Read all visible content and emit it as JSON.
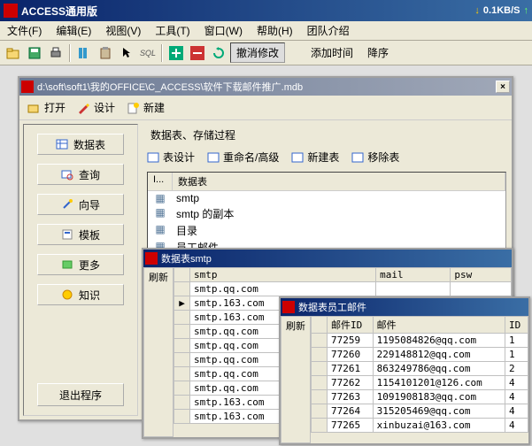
{
  "app": {
    "title": "ACCESS通用版",
    "net_speed": "0.1KB/S"
  },
  "menu": {
    "file": "文件(F)",
    "edit": "编辑(E)",
    "view": "视图(V)",
    "tools": "工具(T)",
    "window": "窗口(W)",
    "help": "帮助(H)",
    "team": "团队介绍"
  },
  "toolbar": {
    "sql": "SQL",
    "undo": "撤消修改",
    "add_time": "添加时间",
    "sort": "降序"
  },
  "dbwin": {
    "title": "d:\\soft\\soft1\\我的OFFICE\\C_ACCESS\\软件下载邮件推广.mdb",
    "open": "打开",
    "design": "设计",
    "new": "新建",
    "section_label": "数据表、存储过程",
    "sub": {
      "design_tbl": "表设计",
      "rename": "重命名/高级",
      "new_tbl": "新建表",
      "del_tbl": "移除表"
    },
    "sidebar": {
      "datatable": "数据表",
      "query": "查询",
      "wizard": "向导",
      "template": "模板",
      "more": "更多",
      "knowledge": "知识",
      "exit": "退出程序"
    },
    "list_headers": {
      "icon": "I...",
      "name": "数据表"
    },
    "tables": [
      "smtp",
      "smtp 的副本",
      "目录",
      "员工邮件"
    ]
  },
  "smtpwin": {
    "title": "数据表smtp",
    "refresh": "刷新",
    "headers": [
      "smtp",
      "mail",
      "psw"
    ],
    "rows": [
      [
        "smtp.qq.com",
        "",
        ""
      ],
      [
        "smtp.163.com",
        "",
        ""
      ],
      [
        "smtp.163.com",
        "",
        ""
      ],
      [
        "smtp.qq.com",
        "",
        ""
      ],
      [
        "smtp.qq.com",
        "",
        ""
      ],
      [
        "smtp.qq.com",
        "",
        ""
      ],
      [
        "smtp.qq.com",
        "",
        ""
      ],
      [
        "smtp.qq.com",
        "",
        ""
      ],
      [
        "smtp.163.com",
        "",
        ""
      ],
      [
        "smtp.163.com",
        "",
        ""
      ]
    ],
    "selected_row": 1
  },
  "emailwin": {
    "title": "数据表员工邮件",
    "refresh": "刷新",
    "headers": [
      "邮件ID",
      "邮件",
      "ID"
    ],
    "rows": [
      [
        "77259",
        "1195084826@qq.com",
        "1"
      ],
      [
        "77260",
        "229148812@qq.com",
        "1"
      ],
      [
        "77261",
        "863249786@qq.com",
        "2"
      ],
      [
        "77262",
        "1154101201@126.com",
        "4"
      ],
      [
        "77263",
        "1091908183@qq.com",
        "4"
      ],
      [
        "77264",
        "315205469@qq.com",
        "4"
      ],
      [
        "77265",
        "xinbuzai@163.com",
        "4"
      ]
    ]
  }
}
